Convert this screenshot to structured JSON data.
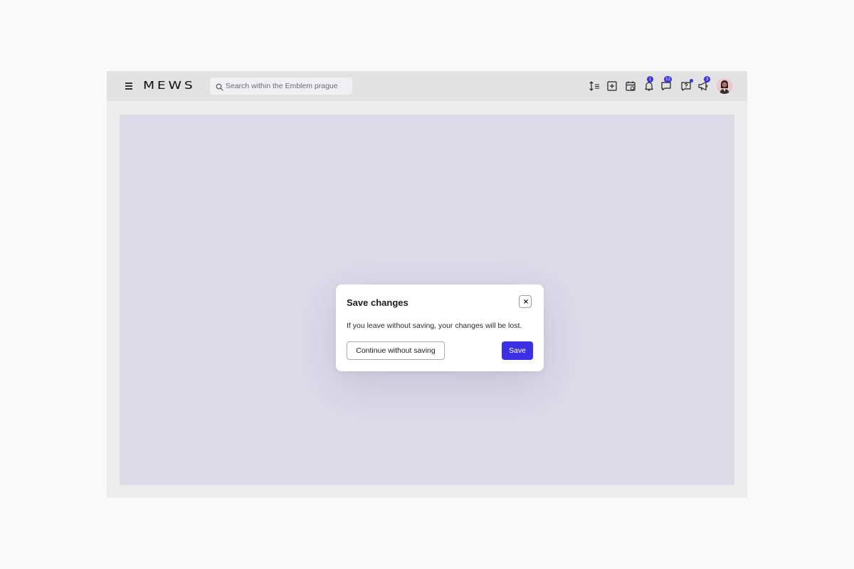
{
  "header": {
    "brand": "MEWS",
    "menu_icon": "hamburger-menu-icon",
    "search": {
      "placeholder": "Search within the Emblem prague",
      "value": "",
      "icon": "search-icon"
    },
    "actions": [
      {
        "name": "sort-order-icon"
      },
      {
        "name": "add-box-icon"
      },
      {
        "name": "calendar-icon"
      },
      {
        "name": "bell-icon",
        "badge": "1"
      },
      {
        "name": "chat-icon",
        "badge": "12"
      },
      {
        "name": "help-chat-icon",
        "dot": true
      },
      {
        "name": "megaphone-icon",
        "badge": "3"
      }
    ],
    "avatar": "user-avatar"
  },
  "modal": {
    "title": "Save changes",
    "close_icon": "close-icon",
    "close_glyph": "×",
    "message": "If you leave without saving, your changes will be lost.",
    "secondary_label": "Continue without saving",
    "primary_label": "Save"
  },
  "colors": {
    "accent": "#3b30e4",
    "topbar": "#e2e2e2",
    "backdrop": "#dddbe8",
    "window": "#ececec"
  }
}
